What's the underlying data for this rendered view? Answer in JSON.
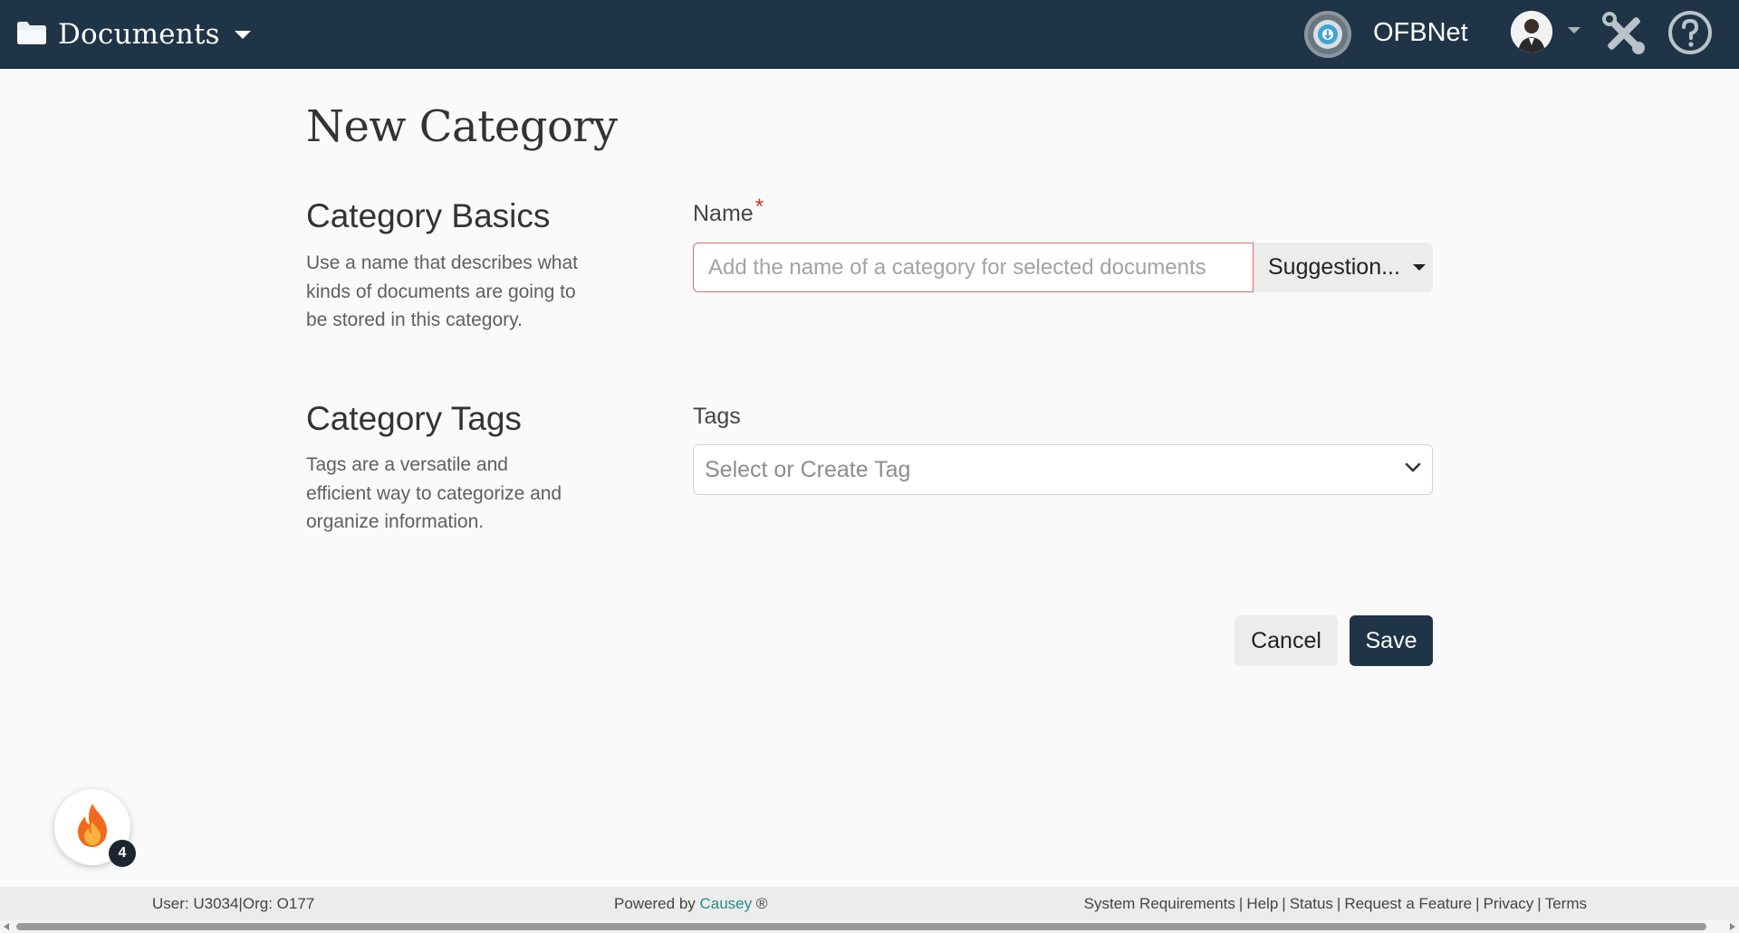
{
  "header": {
    "app_title": "Documents",
    "org_name": "OFBNet",
    "icons": {
      "app": "folder-icon",
      "org_logo": "org-logo-icon",
      "tools": "tools-icon",
      "help": "help-icon"
    },
    "colors": {
      "background": "#1f3547",
      "text": "#ffffff"
    }
  },
  "page": {
    "title": "New Category"
  },
  "sections": {
    "basics": {
      "title": "Category Basics",
      "description": "Use a name that describes what kinds of documents are going to be stored in this category."
    },
    "tags": {
      "title": "Category Tags",
      "description": "Tags are a versatile and efficient way to categorize and organize information."
    }
  },
  "form": {
    "name": {
      "label": "Name",
      "required_marker": "*",
      "value": "",
      "placeholder": "Add the name of a category for selected documents",
      "suggestion_label": "Suggestion..."
    },
    "tags": {
      "label": "Tags",
      "placeholder": "Select or Create Tag"
    }
  },
  "actions": {
    "cancel_label": "Cancel",
    "save_label": "Save",
    "save_color": "#1f3547"
  },
  "fab": {
    "icon": "flame-icon",
    "badge_count": "4"
  },
  "footer": {
    "user_info": "User: U3034|Org: O177",
    "powered_prefix": "Powered by ",
    "powered_brand": "Causey",
    "powered_suffix": " ®",
    "links": [
      "System Requirements",
      "Help",
      "Status",
      "Request a Feature",
      "Privacy",
      "Terms"
    ],
    "brand_color": "#2a8c8c"
  }
}
